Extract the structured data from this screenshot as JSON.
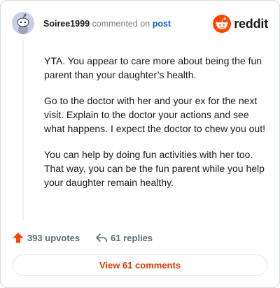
{
  "comment": {
    "author": "Soiree1999",
    "verb": "commented on",
    "post_link": "post",
    "paragraphs": [
      "YTA. You appear to care more about being the fun parent than your daughter’s health.",
      "Go to the doctor with her and your ex for the next visit. Explain to the doctor your actions and see what happens. I expect the doctor to chew you out!",
      "You can help by doing fun activities with her too. That way, you can be the fun parent while you help your daughter remain healthy."
    ]
  },
  "brand": {
    "wordmark": "reddit",
    "color": "#ff4500"
  },
  "actions": {
    "upvotes": "393 upvotes",
    "replies": "61 replies"
  },
  "footer": {
    "view_comments": "View 61 comments"
  },
  "icons": {
    "avatar": "snoo-avatar-icon",
    "logo": "reddit-logo-icon",
    "upvote": "upvote-arrow-icon",
    "reply": "reply-arrow-icon"
  },
  "colors": {
    "upvote": "#ff4500",
    "link": "#0a61c7",
    "view_button_text": "#d93a00"
  }
}
